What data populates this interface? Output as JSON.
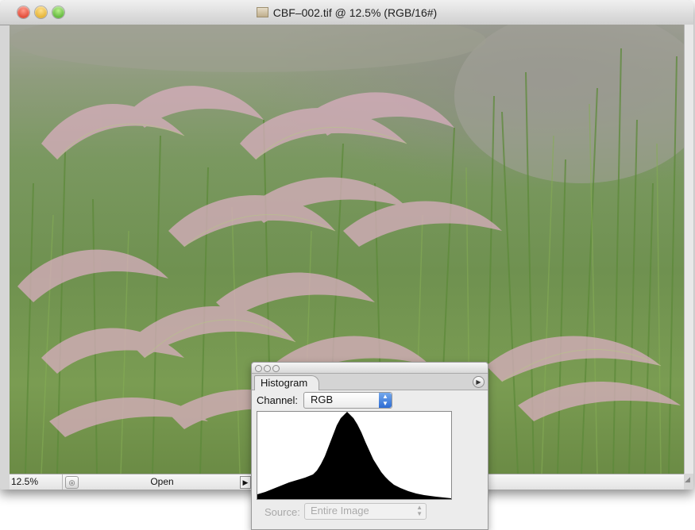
{
  "window": {
    "title": "CBF–002.tif @ 12.5% (RGB/16#)"
  },
  "status_bar": {
    "zoom": "12.5%",
    "info": "Open"
  },
  "histogram_panel": {
    "tab_label": "Histogram",
    "channel_label": "Channel:",
    "channel_value": "RGB",
    "source_label": "Source:",
    "source_value": "Entire Image"
  },
  "colors": {
    "channel_select_arrow": "#2d6cd4",
    "histogram_fill": "#000000"
  }
}
